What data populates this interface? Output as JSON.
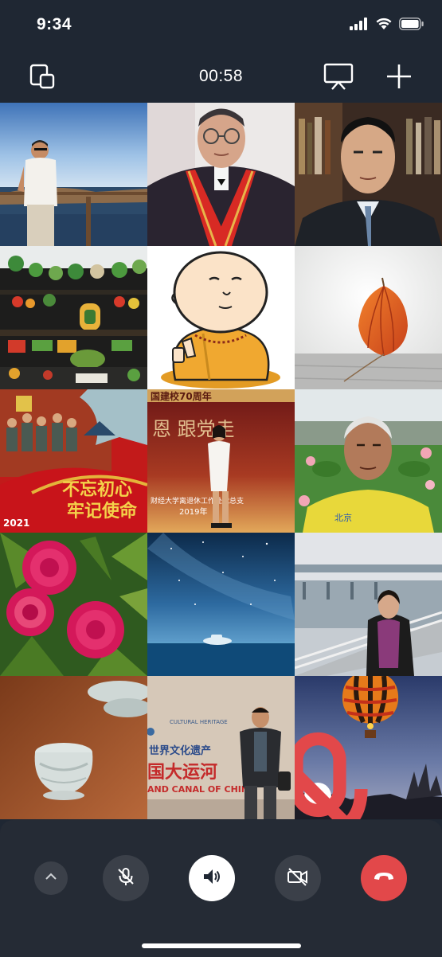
{
  "status_bar": {
    "time": "9:34"
  },
  "call": {
    "duration": "00:58"
  },
  "icons": {
    "window": "switch-window-icon",
    "screen": "screen-share-icon",
    "add": "add-participant-icon"
  },
  "participants": [
    {
      "scene": "man-on-ship-deck"
    },
    {
      "scene": "elderly-man-red-sash"
    },
    {
      "scene": "man-in-suit"
    },
    {
      "scene": "vegetable-display"
    },
    {
      "scene": "cartoon-monk"
    },
    {
      "scene": "orange-lantern-flower"
    },
    {
      "scene": "propaganda-poster",
      "poster_text": [
        "不忘初心",
        "牢记使命"
      ],
      "year": "2021"
    },
    {
      "scene": "woman-on-stage",
      "banner_top": "国建校70周年",
      "banner_mid": "恩  跟党走",
      "banner_low": "财经大学离退休工作处党总支",
      "banner_year": "2019年"
    },
    {
      "scene": "elderly-man-lotus"
    },
    {
      "scene": "pink-peonies"
    },
    {
      "scene": "starry-ocean"
    },
    {
      "scene": "woman-on-bridge"
    },
    {
      "scene": "porcelain-cups"
    },
    {
      "scene": "man-grand-canal",
      "sign_cn": "世界文化遗产",
      "sign_cn2": "国大运河",
      "sign_en": "AND CANAL OF CHINA",
      "sign_sub": "CULTURAL HERITAGE"
    },
    {
      "scene": "hot-air-balloon",
      "muted": true
    }
  ],
  "controls": {
    "colors": {
      "panel": "#252b35",
      "button": "#3b4049",
      "speaker": "#ffffff",
      "hangup": "#e2484a"
    }
  }
}
